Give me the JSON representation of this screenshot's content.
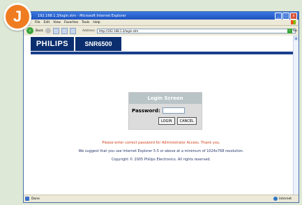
{
  "badge": "J",
  "window": {
    "title": "192.168.1.3/login.stm - Microsoft Internet Explorer",
    "buttons": [
      "_",
      "□",
      "x"
    ]
  },
  "menu": [
    "File",
    "Edit",
    "View",
    "Favorites",
    "Tools",
    "Help"
  ],
  "toolbar": {
    "back_label": "Back",
    "address_label": "Address",
    "url": "http://192.168.1.3/login.stm",
    "go_label": "Go"
  },
  "brand": {
    "name": "PHILIPS",
    "model": "SNR6500"
  },
  "login": {
    "title": "Login Screen",
    "password_label": "Password:",
    "password_value": "",
    "login_button": "LOGIN",
    "cancel_button": "CANCEL"
  },
  "messages": {
    "warning": "Please enter correct password for Administrator Access. Thank you.",
    "suggestion": "We suggest that you use Internet Explorer 5.5 or above at a minimum of 1024x768 resolution.",
    "copyright": "Copyright © 2005 Philips Electronics. All rights reserved."
  },
  "status": {
    "left": "Done",
    "zone": "Internet"
  },
  "colors": {
    "accent": "#f07c21",
    "brand_blue": "#0b2e6e",
    "warning": "#d0421b"
  }
}
